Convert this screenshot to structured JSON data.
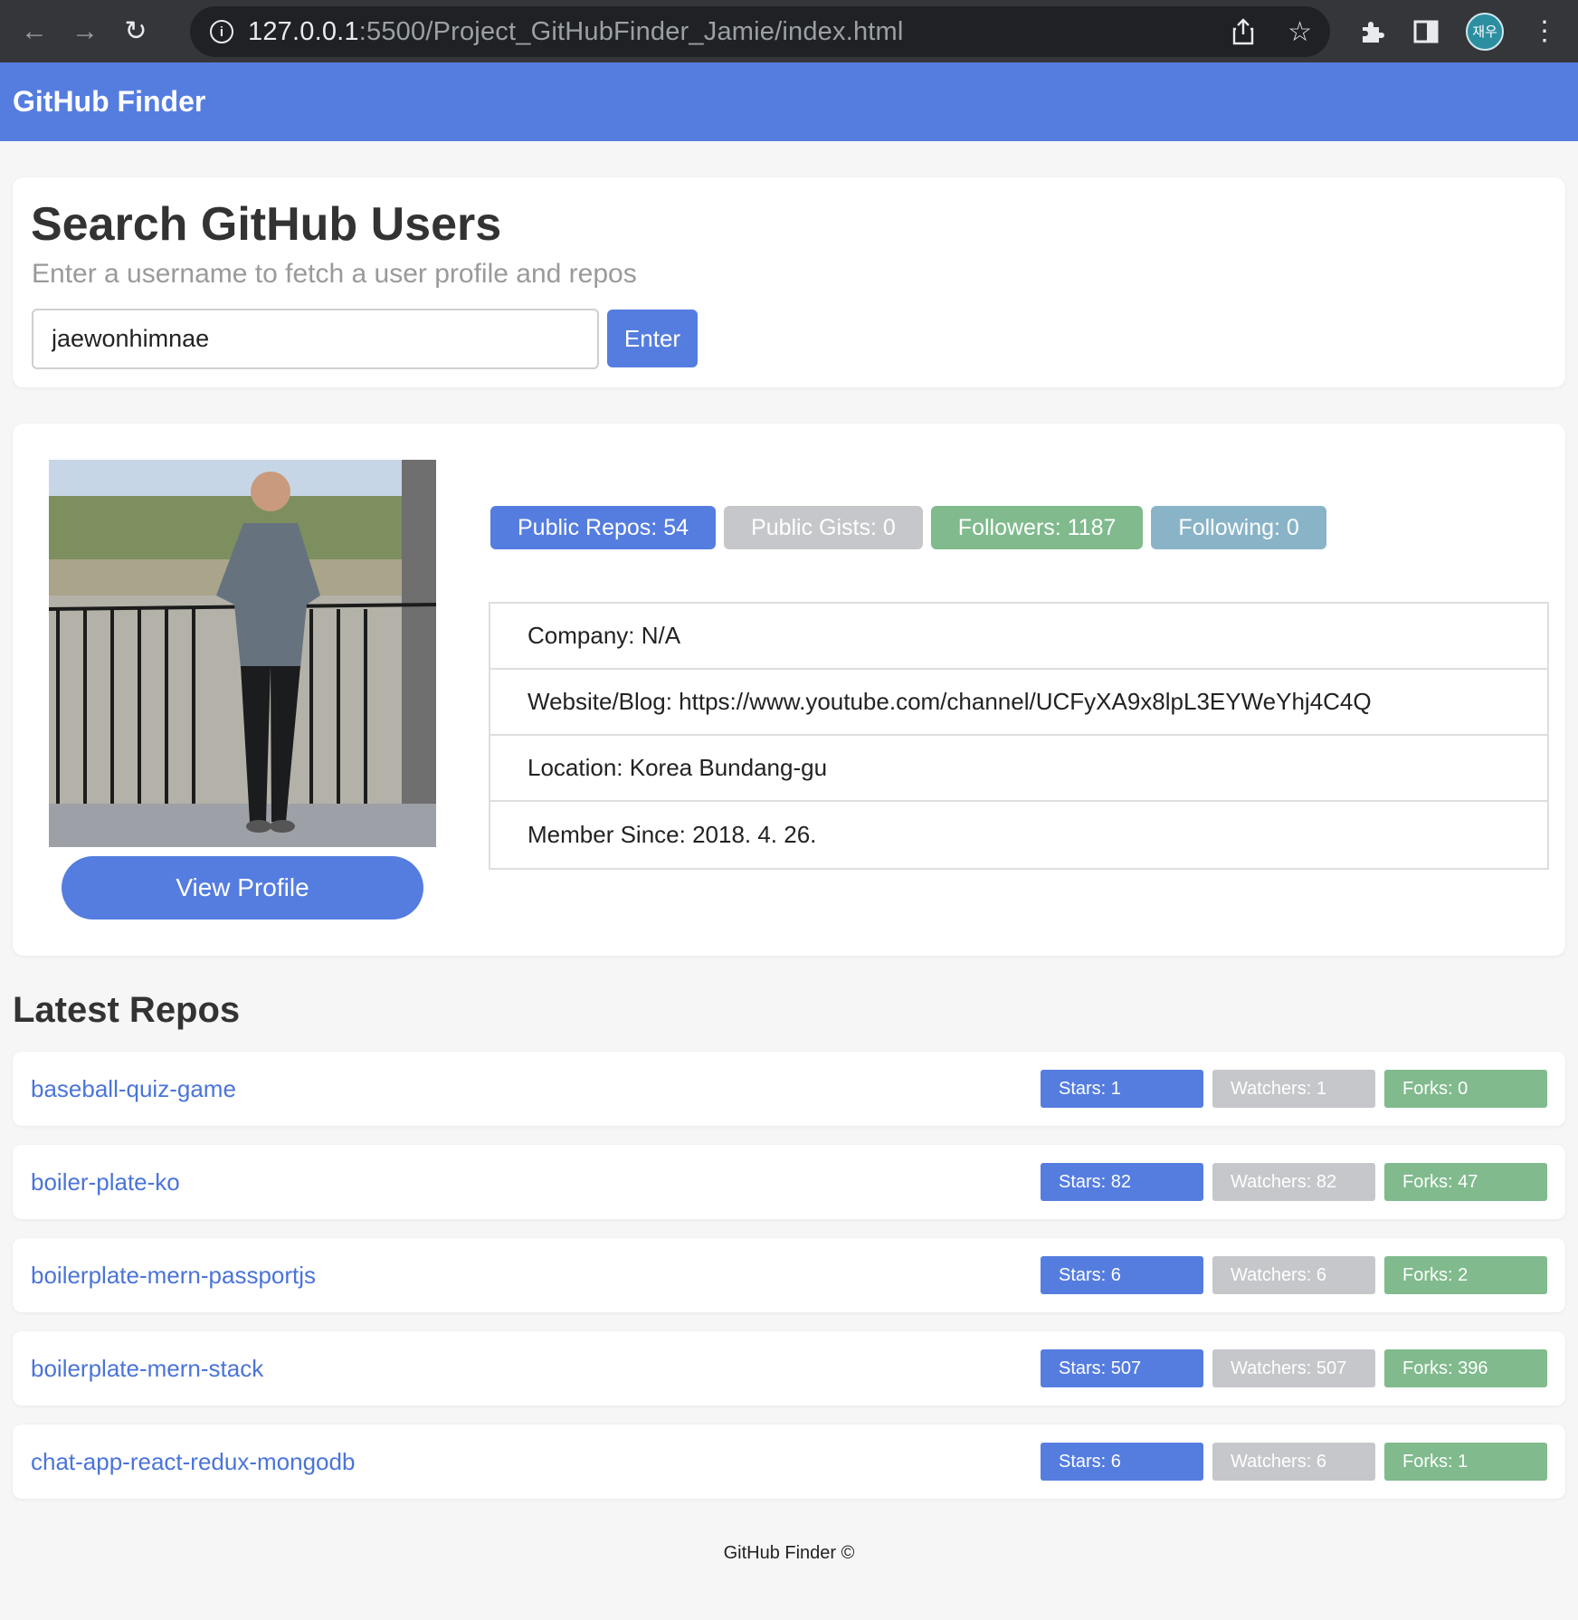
{
  "browser": {
    "url_host": "127.0.0.1",
    "url_rest": ":5500/Project_GitHubFinder_Jamie/index.html",
    "profile_initials": "재우"
  },
  "navbar": {
    "brand": "GitHub Finder"
  },
  "search": {
    "title": "Search GitHub Users",
    "subtitle": "Enter a username to fetch a user profile and repos",
    "input_value": "jaewonhimnae",
    "button_label": "Enter"
  },
  "profile": {
    "view_profile_label": "View Profile",
    "badges": {
      "public_repos": "Public Repos: 54",
      "public_gists": "Public Gists: 0",
      "followers": "Followers: 1187",
      "following": "Following: 0"
    },
    "info": {
      "company": "Company: N/A",
      "website": "Website/Blog: https://www.youtube.com/channel/UCFyXA9x8lpL3EYWeYhj4C4Q",
      "location": "Location: Korea Bundang-gu",
      "member_since": "Member Since: 2018. 4. 26."
    }
  },
  "repos": {
    "heading": "Latest Repos",
    "items": [
      {
        "name": "baseball-quiz-game",
        "stars": "Stars: 1",
        "watchers": "Watchers: 1",
        "forks": "Forks: 0"
      },
      {
        "name": "boiler-plate-ko",
        "stars": "Stars: 82",
        "watchers": "Watchers: 82",
        "forks": "Forks: 47"
      },
      {
        "name": "boilerplate-mern-passportjs",
        "stars": "Stars: 6",
        "watchers": "Watchers: 6",
        "forks": "Forks: 2"
      },
      {
        "name": "boilerplate-mern-stack",
        "stars": "Stars: 507",
        "watchers": "Watchers: 507",
        "forks": "Forks: 396"
      },
      {
        "name": "chat-app-react-redux-mongodb",
        "stars": "Stars: 6",
        "watchers": "Watchers: 6",
        "forks": "Forks: 1"
      }
    ]
  },
  "footer": {
    "text": "GitHub Finder ©"
  },
  "colors": {
    "primary": "#557de0",
    "gray_badge": "#c6c7cb",
    "green_badge": "#80ba8d",
    "teal_badge": "#89b4c8",
    "link": "#4a74d9"
  }
}
